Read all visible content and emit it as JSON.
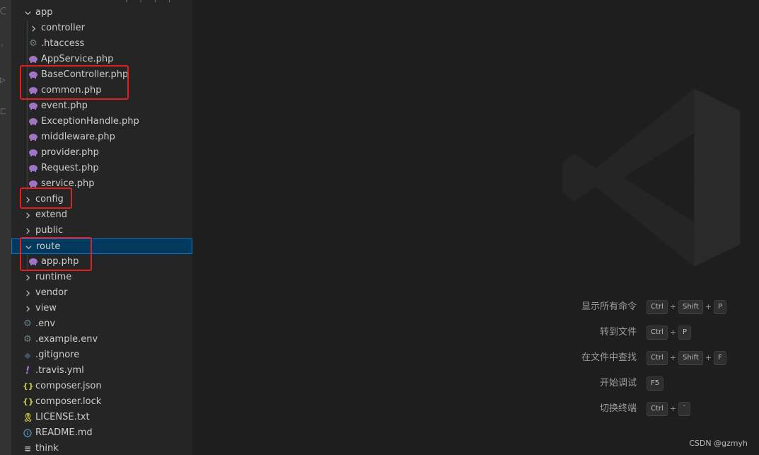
{
  "explorer": {
    "items": [
      {
        "label": "app",
        "kind": "folder",
        "expanded": true,
        "depth": 1,
        "icon": "chevron-down-icon"
      },
      {
        "label": "controller",
        "kind": "folder",
        "expanded": false,
        "depth": 2,
        "icon": "chevron-right-icon"
      },
      {
        "label": ".htaccess",
        "kind": "file",
        "depth": 2,
        "icon": "gear-icon"
      },
      {
        "label": "AppService.php",
        "kind": "file",
        "depth": 2,
        "icon": "php-elephant-icon"
      },
      {
        "label": "BaseController.php",
        "kind": "file",
        "depth": 2,
        "icon": "php-elephant-icon"
      },
      {
        "label": "common.php",
        "kind": "file",
        "depth": 2,
        "icon": "php-elephant-icon"
      },
      {
        "label": "event.php",
        "kind": "file",
        "depth": 2,
        "icon": "php-elephant-icon"
      },
      {
        "label": "ExceptionHandle.php",
        "kind": "file",
        "depth": 2,
        "icon": "php-elephant-icon"
      },
      {
        "label": "middleware.php",
        "kind": "file",
        "depth": 2,
        "icon": "php-elephant-icon"
      },
      {
        "label": "provider.php",
        "kind": "file",
        "depth": 2,
        "icon": "php-elephant-icon"
      },
      {
        "label": "Request.php",
        "kind": "file",
        "depth": 2,
        "icon": "php-elephant-icon"
      },
      {
        "label": "service.php",
        "kind": "file",
        "depth": 2,
        "icon": "php-elephant-icon"
      },
      {
        "label": "config",
        "kind": "folder",
        "expanded": false,
        "depth": 1,
        "icon": "chevron-right-icon"
      },
      {
        "label": "extend",
        "kind": "folder",
        "expanded": false,
        "depth": 1,
        "icon": "chevron-right-icon"
      },
      {
        "label": "public",
        "kind": "folder",
        "expanded": false,
        "depth": 1,
        "icon": "chevron-right-icon"
      },
      {
        "label": "route",
        "kind": "folder",
        "expanded": true,
        "depth": 1,
        "icon": "chevron-down-icon",
        "selected": true
      },
      {
        "label": "app.php",
        "kind": "file",
        "depth": 2,
        "icon": "php-elephant-icon"
      },
      {
        "label": "runtime",
        "kind": "folder",
        "expanded": false,
        "depth": 1,
        "icon": "chevron-right-icon"
      },
      {
        "label": "vendor",
        "kind": "folder",
        "expanded": false,
        "depth": 1,
        "icon": "chevron-right-icon"
      },
      {
        "label": "view",
        "kind": "folder",
        "expanded": false,
        "depth": 1,
        "icon": "chevron-right-icon"
      },
      {
        "label": ".env",
        "kind": "file",
        "depth": 1,
        "icon": "gear-icon"
      },
      {
        "label": ".example.env",
        "kind": "file",
        "depth": 1,
        "icon": "gear-icon"
      },
      {
        "label": ".gitignore",
        "kind": "file",
        "depth": 1,
        "icon": "git-diamond-icon"
      },
      {
        "label": ".travis.yml",
        "kind": "file",
        "depth": 1,
        "icon": "exclamation-icon"
      },
      {
        "label": "composer.json",
        "kind": "file",
        "depth": 1,
        "icon": "json-braces-icon"
      },
      {
        "label": "composer.lock",
        "kind": "file",
        "depth": 1,
        "icon": "json-braces-icon"
      },
      {
        "label": "LICENSE.txt",
        "kind": "file",
        "depth": 1,
        "icon": "license-ribbon-icon"
      },
      {
        "label": "README.md",
        "kind": "file",
        "depth": 1,
        "icon": "info-icon"
      },
      {
        "label": "think",
        "kind": "file",
        "depth": 1,
        "icon": "lines-icon"
      }
    ]
  },
  "editor": {
    "shortcuts": [
      {
        "label": "显示所有命令",
        "keys": [
          "Ctrl",
          "Shift",
          "P"
        ]
      },
      {
        "label": "转到文件",
        "keys": [
          "Ctrl",
          "P"
        ]
      },
      {
        "label": "在文件中查找",
        "keys": [
          "Ctrl",
          "Shift",
          "F"
        ]
      },
      {
        "label": "开始调试",
        "keys": [
          "F5"
        ]
      },
      {
        "label": "切换终端",
        "keys": [
          "Ctrl",
          "`"
        ]
      }
    ],
    "plus_sign": "+"
  },
  "credit": "CSDN @gzmyh",
  "colors": {
    "sidebar_bg": "#252526",
    "editor_bg": "#1e1e1e",
    "selection_bg": "#04395e",
    "selection_border": "#0078d4",
    "highlight_box": "#e02020",
    "php_icon": "#a074c4",
    "gear_icon": "#6d8086",
    "json_icon": "#cbcb41",
    "exclamation_icon": "#a074c4",
    "license_icon": "#cbcb41",
    "info_icon": "#519aba"
  }
}
